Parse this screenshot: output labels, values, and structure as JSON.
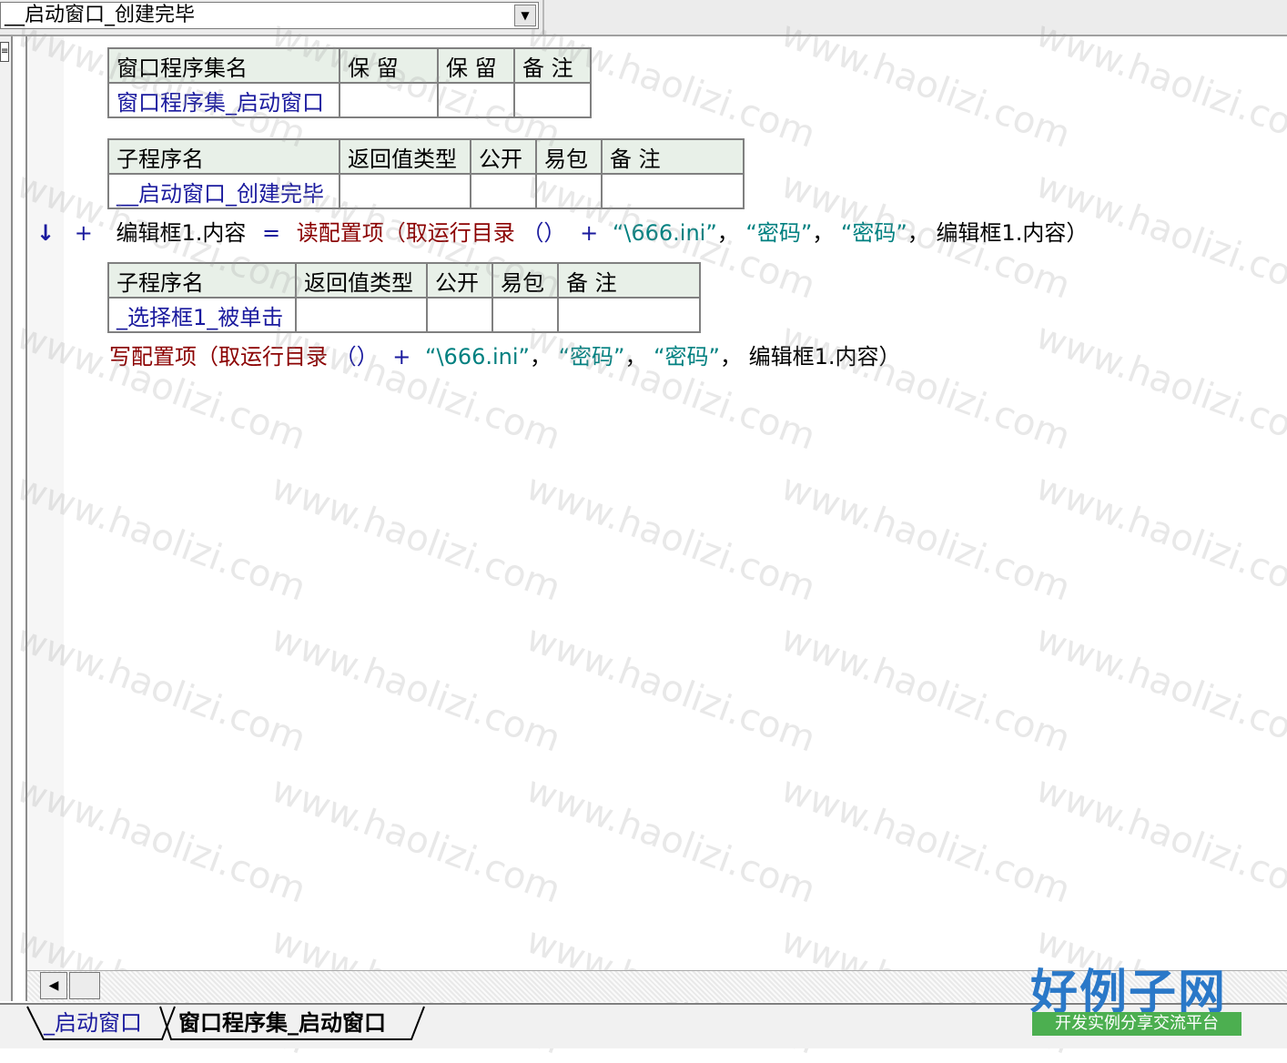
{
  "top_combo": {
    "value": "__启动窗口_创建完毕"
  },
  "assembly_table": {
    "headers": [
      "窗口程序集名",
      "保 留",
      "保 留",
      "备 注"
    ],
    "row": [
      "窗口程序集_启动窗口",
      "",
      "",
      ""
    ]
  },
  "sub1_table": {
    "headers": [
      "子程序名",
      "返回值类型",
      "公开",
      "易包",
      "备 注"
    ],
    "row": [
      "__启动窗口_创建完毕",
      "",
      "",
      "",
      ""
    ]
  },
  "line1": {
    "arrow": "↓",
    "plus": "+",
    "lhs": "编辑框1.内容",
    "eq": "=",
    "func": "读配置项",
    "open": "（",
    "func2": "取运行目录",
    "call": "（）",
    "plus2": "+",
    "str1": "“\\666.ini”",
    "comma1": "，",
    "str2": "“密码”",
    "comma2": "，",
    "str3": "“密码”",
    "comma3": "，",
    "arg4": "编辑框1.内容",
    "close": "）"
  },
  "sub2_table": {
    "headers": [
      "子程序名",
      "返回值类型",
      "公开",
      "易包",
      "备 注"
    ],
    "row": [
      "_选择框1_被单击",
      "",
      "",
      "",
      ""
    ]
  },
  "line2": {
    "func": "写配置项",
    "open": "（",
    "func2": "取运行目录",
    "call": "（）",
    "plus2": "+",
    "str1": "“\\666.ini”",
    "comma1": "，",
    "str2": "“密码”",
    "comma2": "，",
    "str3": "“密码”",
    "comma3": "，",
    "arg4": "编辑框1.内容",
    "close": "）"
  },
  "tabs": [
    "_启动窗口",
    "窗口程序集_启动窗口"
  ],
  "watermark_text": "www.haolizi.com",
  "logo": {
    "main": "好例子网",
    "sub": "开发实例分享交流平台"
  },
  "colors": {
    "keyword_red": "#8b0000",
    "string_teal": "#008080",
    "name_blue": "#1a1a9e",
    "header_bg": "#e8f0e8"
  }
}
